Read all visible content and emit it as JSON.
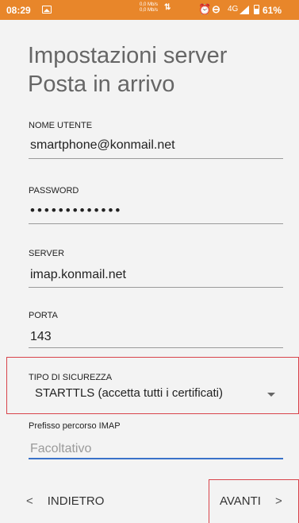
{
  "status_bar": {
    "time": "08:29",
    "speed_up": "0,0 Mb/s",
    "speed_down": "0,0 Mb/s",
    "network": "4G",
    "battery": "61%",
    "icons": [
      "image-icon",
      "data-arrows-icon",
      "alarm-icon",
      "do-not-disturb-icon",
      "signal-icon",
      "battery-icon"
    ]
  },
  "page": {
    "title": "Impostazioni server Posta in arrivo"
  },
  "form": {
    "username": {
      "label": "NOME UTENTE",
      "value": "smartphone@konmail.net"
    },
    "password": {
      "label": "PASSWORD",
      "value": "•••••••••••••"
    },
    "server": {
      "label": "SERVER",
      "value": "imap.konmail.net"
    },
    "port": {
      "label": "PORTA",
      "value": "143"
    },
    "security": {
      "label": "TIPO DI SICUREZZA",
      "value": "STARTTLS (accetta tutti i certificati)"
    },
    "imap_prefix": {
      "label": "Prefisso percorso IMAP",
      "placeholder": "Facoltativo"
    }
  },
  "nav": {
    "back_label": "INDIETRO",
    "next_label": "AVANTI",
    "back_chevron": "<",
    "next_chevron": ">"
  },
  "colors": {
    "status_bar": "#e8862a",
    "highlight": "#d8434a",
    "focus_underline": "#3a72c9",
    "background": "#f3f3f3"
  }
}
